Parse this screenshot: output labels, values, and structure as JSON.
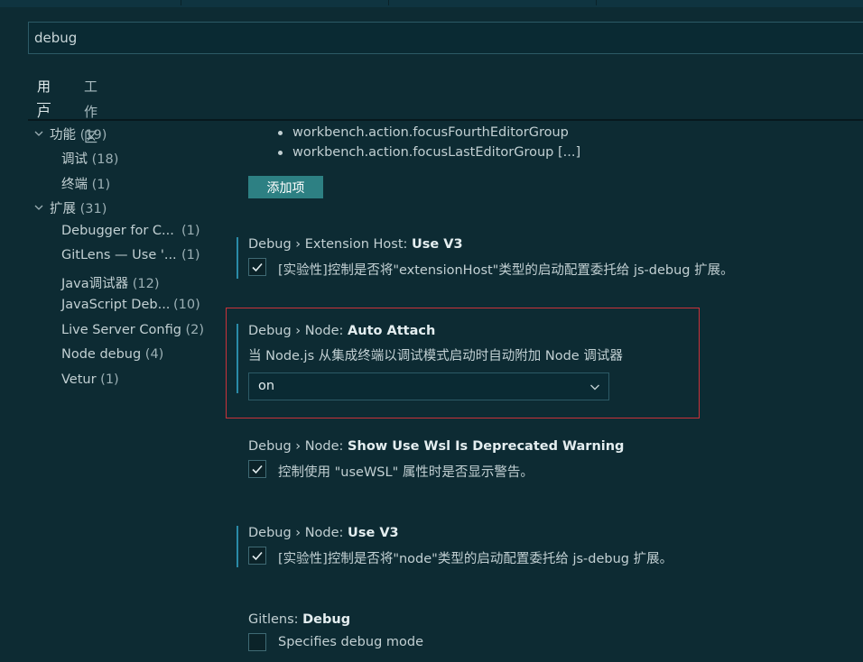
{
  "search": {
    "value": "debug"
  },
  "scope_tabs": [
    {
      "label": "用户",
      "active": true
    },
    {
      "label": "工作区",
      "active": false
    }
  ],
  "toc": [
    {
      "label": "功能",
      "count": "(19)",
      "expanded": true,
      "level": 0
    },
    {
      "label": "调试",
      "count": "(18)",
      "level": 1
    },
    {
      "label": "终端",
      "count": "(1)",
      "level": 1
    },
    {
      "label": "扩展",
      "count": "(31)",
      "expanded": true,
      "level": 0
    },
    {
      "label": "Debugger for C...",
      "count": "(1)",
      "level": 1
    },
    {
      "label": "GitLens — Use '...",
      "count": "(1)",
      "level": 1
    },
    {
      "label": "Java调试器",
      "count": "(12)",
      "level": 1
    },
    {
      "label": "JavaScript Deb...",
      "count": "(10)",
      "level": 1
    },
    {
      "label": "Live Server Config",
      "count": "(2)",
      "level": 1
    },
    {
      "label": "Node debug",
      "count": "(4)",
      "level": 1
    },
    {
      "label": "Vetur",
      "count": "(1)",
      "level": 1
    }
  ],
  "list_items": [
    "workbench.action.focusFourthEditorGroup",
    "workbench.action.focusLastEditorGroup [...]"
  ],
  "add_button": "添加项",
  "settings": [
    {
      "prefix": "Debug › Extension Host: ",
      "name": "Use V3",
      "description": "[实验性]控制是否将\"extensionHost\"类型的启动配置委托给 js-debug 扩展。",
      "checked": true
    },
    {
      "prefix": "Debug › Node: ",
      "name": "Auto Attach",
      "description": "当 Node.js 从集成终端以调试模式启动时自动附加 Node 调试器",
      "select_value": "on"
    },
    {
      "prefix": "Debug › Node: ",
      "name": "Show Use Wsl Is Deprecated Warning",
      "description": "控制使用 \"useWSL\" 属性时是否显示警告。",
      "checked": true
    },
    {
      "prefix": "Debug › Node: ",
      "name": "Use V3",
      "description": "[实验性]控制是否将\"node\"类型的启动配置委托给 js-debug 扩展。",
      "checked": true
    },
    {
      "prefix": "Gitlens: ",
      "name": "Debug",
      "description": "Specifies debug mode",
      "checked": false
    }
  ],
  "colors": {
    "background": "#0d2b33",
    "button": "#2d8083",
    "modified_bar": "#2a8ba8",
    "highlight_border": "#c9323a"
  },
  "icons": {
    "expand": "chevron-down-icon",
    "check": "check-icon",
    "dropdown": "chevron-down-icon"
  }
}
